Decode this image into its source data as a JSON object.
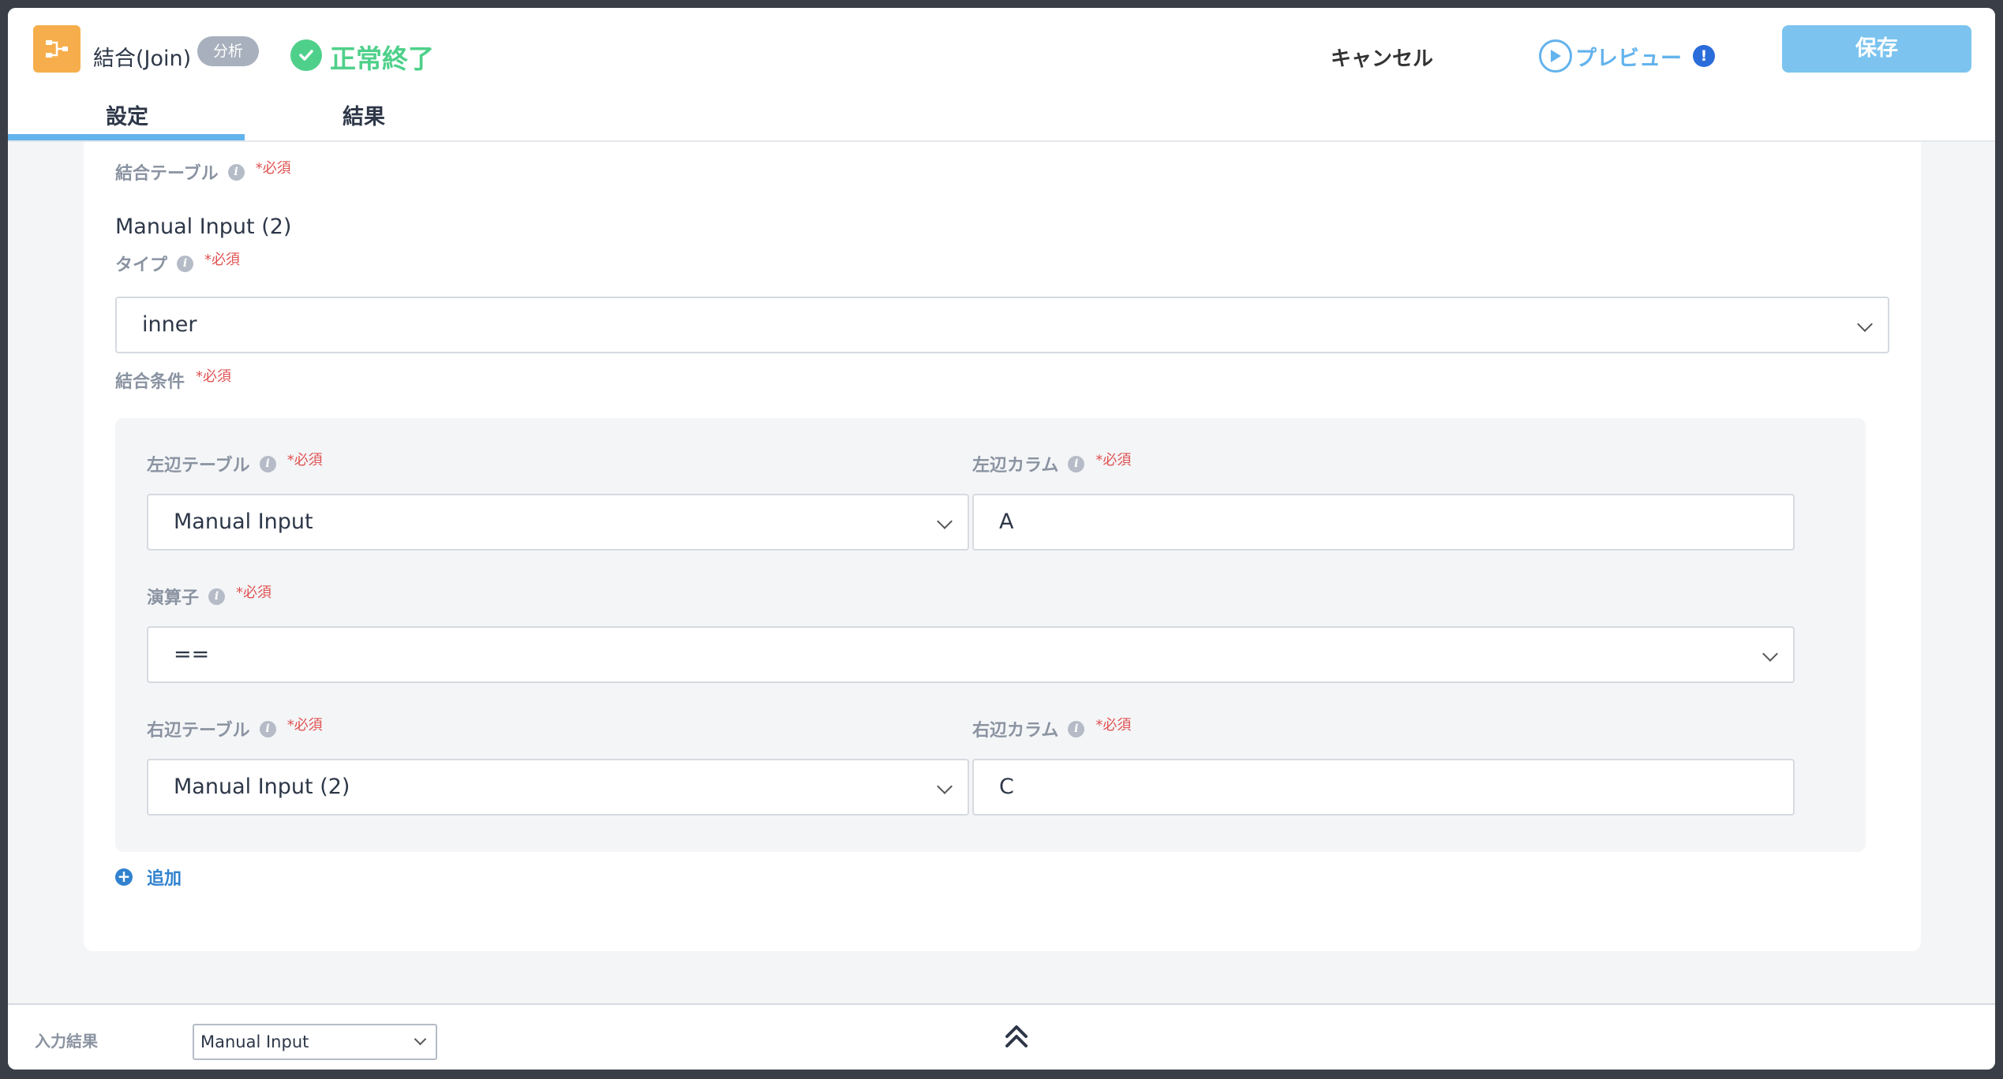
{
  "header": {
    "title": "結合(Join)",
    "badge": "分析",
    "status": "正常終了",
    "cancel_label": "キャンセル",
    "preview_label": "プレビュー",
    "warning_mark": "!",
    "save_label": "保存",
    "node_icon": "join-icon",
    "accent_color": "#63b3ed",
    "status_color": "#4fd08a"
  },
  "tabs": [
    {
      "label": "設定",
      "active": true
    },
    {
      "label": "結果",
      "active": false
    }
  ],
  "form": {
    "required_mark": "*必須",
    "join_table": {
      "label": "結合テーブル",
      "value": "Manual Input (2)"
    },
    "type": {
      "label": "タイプ",
      "value": "inner"
    },
    "conditions_label": "結合条件",
    "condition": {
      "left_table": {
        "label": "左辺テーブル",
        "value": "Manual Input"
      },
      "left_column": {
        "label": "左辺カラム",
        "value": "A"
      },
      "operator": {
        "label": "演算子",
        "value": "=="
      },
      "right_table": {
        "label": "右辺テーブル",
        "value": "Manual Input (2)"
      },
      "right_column": {
        "label": "右辺カラム",
        "value": "C"
      }
    },
    "add_label": "追加"
  },
  "bottom": {
    "input_result_label": "入力結果",
    "input_result_value": "Manual Input"
  }
}
